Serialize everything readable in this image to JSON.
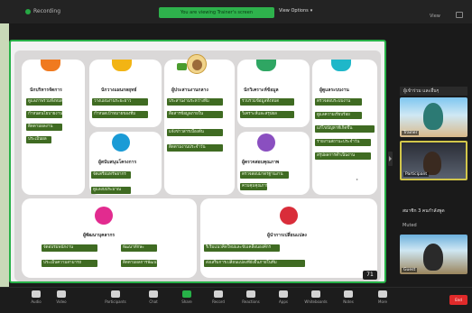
{
  "topbar": {
    "recording_label": "Recording",
    "share_banner": "You are viewing Trainer's screen",
    "view_label": "View Options",
    "top_right_label": "View"
  },
  "slide": {
    "roles": [
      {
        "label": "นักบริหารจัดการ",
        "color": "#f07a1f",
        "items": [
          "ดูแลภาพรวมทั้งหมด",
          "กำหนดนโยบายงาน",
          "ติดตามผลงาน",
          "ประเมินผล"
        ]
      },
      {
        "label": "นักวางแผนกลยุทธ์",
        "color": "#f2b414",
        "items": [
          "วางแผนงานระยะยาว",
          "กำหนดเป้าหมายของทีม"
        ]
      },
      {
        "label": "ผู้ประสานงานกลาง",
        "color": "#7dbb3a",
        "items": [
          "ประสานงานระหว่างทีม",
          "สื่อสารข้อมูลภายใน",
          "แจ้งข่าวสารเบื้องต้น",
          "ติดตามงานประจำวัน"
        ]
      },
      {
        "label": "นักวิเคราะห์ข้อมูล",
        "color": "#2fa663",
        "items": [
          "รวบรวมข้อมูลทั้งหมด",
          "วิเคราะห์และสรุปผล"
        ]
      },
      {
        "label": "ผู้ดูแลระบบงาน",
        "color": "#1fb7c9",
        "items": [
          "ตรวจสอบระบบงาน",
          "ดูแลความเรียบร้อย",
          "แก้ไขปัญหาที่เกิดขึ้น",
          "รายงานสถานะประจำวัน",
          "สรุปผลการดำเนินงาน"
        ]
      },
      {
        "label": "ผู้สนับสนุนโครงการ",
        "color": "#1a9bd6",
        "items": [
          "จัดเตรียมทรัพยากร",
          "ดูแลงบประมาณ"
        ]
      },
      {
        "label": "ผู้ตรวจสอบคุณภาพ",
        "color": "#8a4fc0",
        "items": [
          "ตรวจสอบมาตรฐานงาน",
          "ควบคุมคุณภาพ"
        ]
      },
      {
        "label": "ผู้พัฒนาบุคลากร",
        "color": "#e22b8f",
        "items": [
          "จัดอบรมพนักงาน",
          "พัฒนาทักษะ",
          "ประเมินความสามารถ",
          "ติดตามผลการพัฒนา"
        ]
      },
      {
        "label": "ผู้นำการเปลี่ยนแปลง",
        "color": "#d92d3a",
        "items": [
          "ริเริ่มแนวคิดใหม่และขับเคลื่อนองค์กร",
          "ส่งเสริมการเปลี่ยนแปลงที่ยั่งยืนภายในทีม"
        ]
      }
    ],
    "page_number": "71"
  },
  "gallery": {
    "header": "ผู้เข้าร่วม และอื่นๆ",
    "mid_label": "สมาชิก 3 คนกำลังพูด",
    "mic_row": "Muted",
    "tiles": [
      {
        "name": "Trainer"
      },
      {
        "name": "Participant"
      },
      {
        "name": "Guest"
      }
    ]
  },
  "toolbar": {
    "buttons": [
      {
        "label": "Audio",
        "icon": "microphone-icon"
      },
      {
        "label": "Video",
        "icon": "video-camera-icon"
      },
      {
        "label": "Participants",
        "icon": "participants-icon"
      },
      {
        "label": "Chat",
        "icon": "chat-icon"
      },
      {
        "label": "Share",
        "icon": "share-screen-icon"
      },
      {
        "label": "Record",
        "icon": "record-icon"
      },
      {
        "label": "Reactions",
        "icon": "reactions-icon"
      },
      {
        "label": "Apps",
        "icon": "apps-icon"
      },
      {
        "label": "Whiteboards",
        "icon": "whiteboard-icon"
      },
      {
        "label": "Notes",
        "icon": "notes-icon"
      },
      {
        "label": "More",
        "icon": "more-icon"
      }
    ],
    "end_label": "End"
  }
}
